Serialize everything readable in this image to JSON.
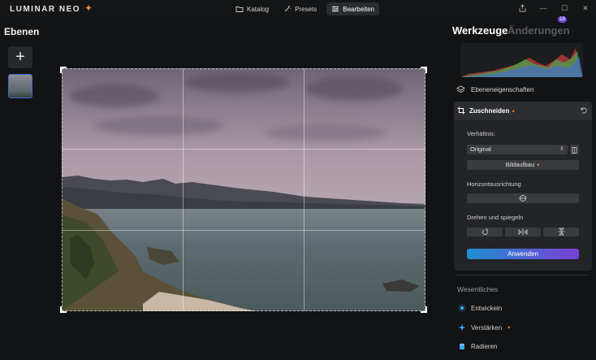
{
  "app": {
    "logo_text": "LUMINAR NEO"
  },
  "tabs": [
    {
      "label": "Katalog",
      "icon": "folder-icon"
    },
    {
      "label": "Presets",
      "icon": "magic-wand-icon"
    },
    {
      "label": "Bearbeiten",
      "icon": "sliders-icon",
      "active": true
    }
  ],
  "left_panel": {
    "title": "Ebenen"
  },
  "right_panel": {
    "title": "Werkzeuge",
    "title_alt": "Änderungen",
    "changes_badge": "18",
    "layer_properties": "Ebeneneigenschaften",
    "crop": {
      "title": "Zuschneiden",
      "ratio_label": "Verhältnis:",
      "ratio_value": "Original",
      "composition_button": "Bildaufbau",
      "horizon_label": "Horizontausrichtung",
      "rotate_label": "Drehen und spiegeln",
      "apply_button": "Anwenden"
    },
    "section_title": "Wesentliches",
    "tools": [
      {
        "label": "Entwickeln",
        "icon": "sun-icon"
      },
      {
        "label": "Verstärken",
        "icon": "sparkle-icon"
      },
      {
        "label": "Radieren",
        "icon": "eraser-icon"
      }
    ]
  },
  "colors": {
    "accent_blue": "#3d6ad6",
    "apply_gradient_start": "#1f8fd0",
    "apply_gradient_end": "#7a3fd6",
    "ai_mark": "#f08a3c"
  }
}
